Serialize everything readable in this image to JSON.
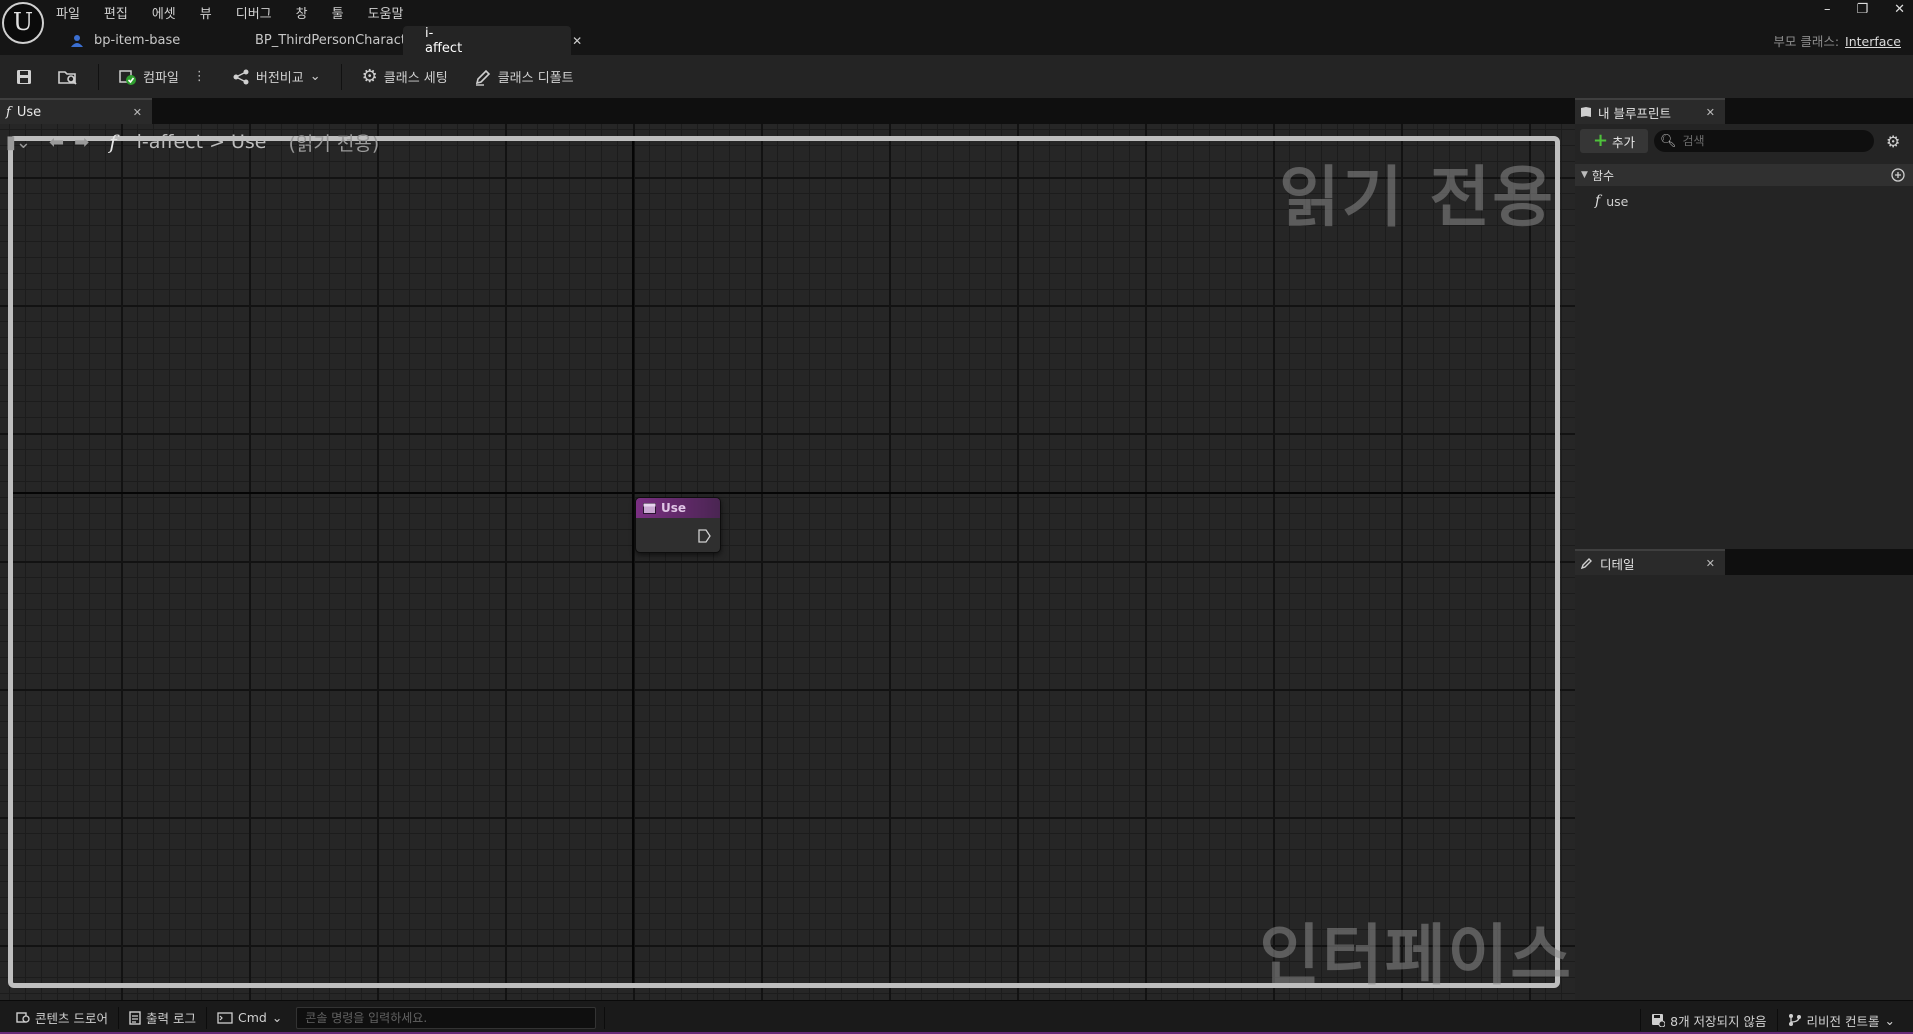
{
  "menu": [
    "파일",
    "편집",
    "에셋",
    "뷰",
    "디버그",
    "창",
    "툴",
    "도움말"
  ],
  "tabs": [
    {
      "label": "bp-item-base",
      "active": false
    },
    {
      "label": "BP_ThirdPersonCharacter",
      "active": false
    },
    {
      "label": "i-affect",
      "active": true
    }
  ],
  "window_controls": {
    "minimize": "–",
    "restore": "❐",
    "close": "✕"
  },
  "parent_class": {
    "label": "부모 클래스:",
    "value": "Interface"
  },
  "toolbar": {
    "compile": "컴파일",
    "diff": "버전비교",
    "class_settings": "클래스 세팅",
    "class_defaults": "클래스 디폴트"
  },
  "graph_tab": {
    "label": "Use"
  },
  "breadcrumb": {
    "func_symbol": "f",
    "root": "i-affect",
    "separator": ">",
    "current": "Use",
    "readonly": "(읽기 전용)"
  },
  "watermarks": {
    "readonly": "읽기 전용",
    "interface": "인터페이스"
  },
  "node": {
    "title": "Use",
    "accent": "#7a2f82"
  },
  "my_blueprint": {
    "tab_label": "내 블루프린트",
    "add_label": "추가",
    "search_placeholder": "검색",
    "category": "함수",
    "functions": [
      "use"
    ]
  },
  "details": {
    "tab_label": "디테일"
  },
  "statusbar": {
    "content_drawer": "콘텐츠 드로어",
    "output_log": "출력 로그",
    "cmd": "Cmd",
    "cmd_placeholder": "콘솔 명령을 입력하세요.",
    "unsaved": "8개 저장되지 않음",
    "revision": "리비전 컨트롤"
  }
}
